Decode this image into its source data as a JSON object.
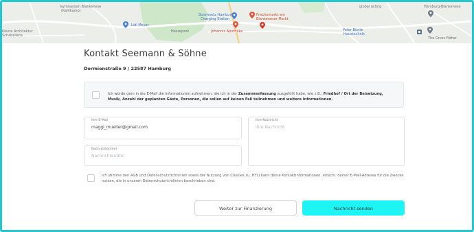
{
  "map": {
    "labels": {
      "gymnasium": "Gymnasium Blankenese",
      "gymnasium_sub": "(Kahlkamp)",
      "lidl": "Lidl Meyer",
      "hessepark": "Hessepark",
      "charging": "Stromnetz Hamburg",
      "charging_sub": "Charging Station",
      "apotheke": "Johannis Apotheke",
      "markt": "Frischemarkt am",
      "markt_sub": "Blankeneser Markt",
      "peter": "Peter Bünte",
      "peter_sub": "Haustechnik",
      "global": "global acting",
      "hamburg": "Hamburg-Blankenese",
      "gross": "The Gross Fidher",
      "left_top": "Kleine Architektur",
      "left_bottom": "Schabellens"
    }
  },
  "form": {
    "title": "Kontakt Seemann & Söhne",
    "address": "Dormienstraße 9 / 22587 Hamburg",
    "consent": {
      "part1": "Ich würde gern in die E-Mail die Informationen aufnehmen, die ich in der ",
      "bold1": "Zusammenfassung",
      "part2": " ausgefüllt habe, wie z.B.: ",
      "bold2": "Friedhof / Ort der Beisetzung, Musik, Anzahl der geplanten Gäste, Personen, die sollen auf keinen Fall teilnehmen und weitere Informationen."
    },
    "email": {
      "label": "Ihre E-Mail",
      "value": "maggi_mueller@gmail.com"
    },
    "subject": {
      "label": "Nachrichtentitel",
      "placeholder": "Nachrichtentitel"
    },
    "message": {
      "label": "Ihre Nachricht",
      "placeholder": "Ihre Nachricht"
    },
    "terms": "Ich stimme den AGB und Datenschutzrichtlinien sowie der Nutzung von Cookies zu. HYLI kann deine Kontaktinformationen, einschl. deiner E-Mail-Adresse für die Zwecke nutzen, die in unseren Datenschutzrichtlinien beschrieben sind.",
    "buttons": {
      "secondary": "Weiter zur Finanzierung",
      "primary": "Nachricht senden"
    }
  },
  "colors": {
    "accent": "#1ef4f4",
    "frame": "#27c7cf"
  }
}
